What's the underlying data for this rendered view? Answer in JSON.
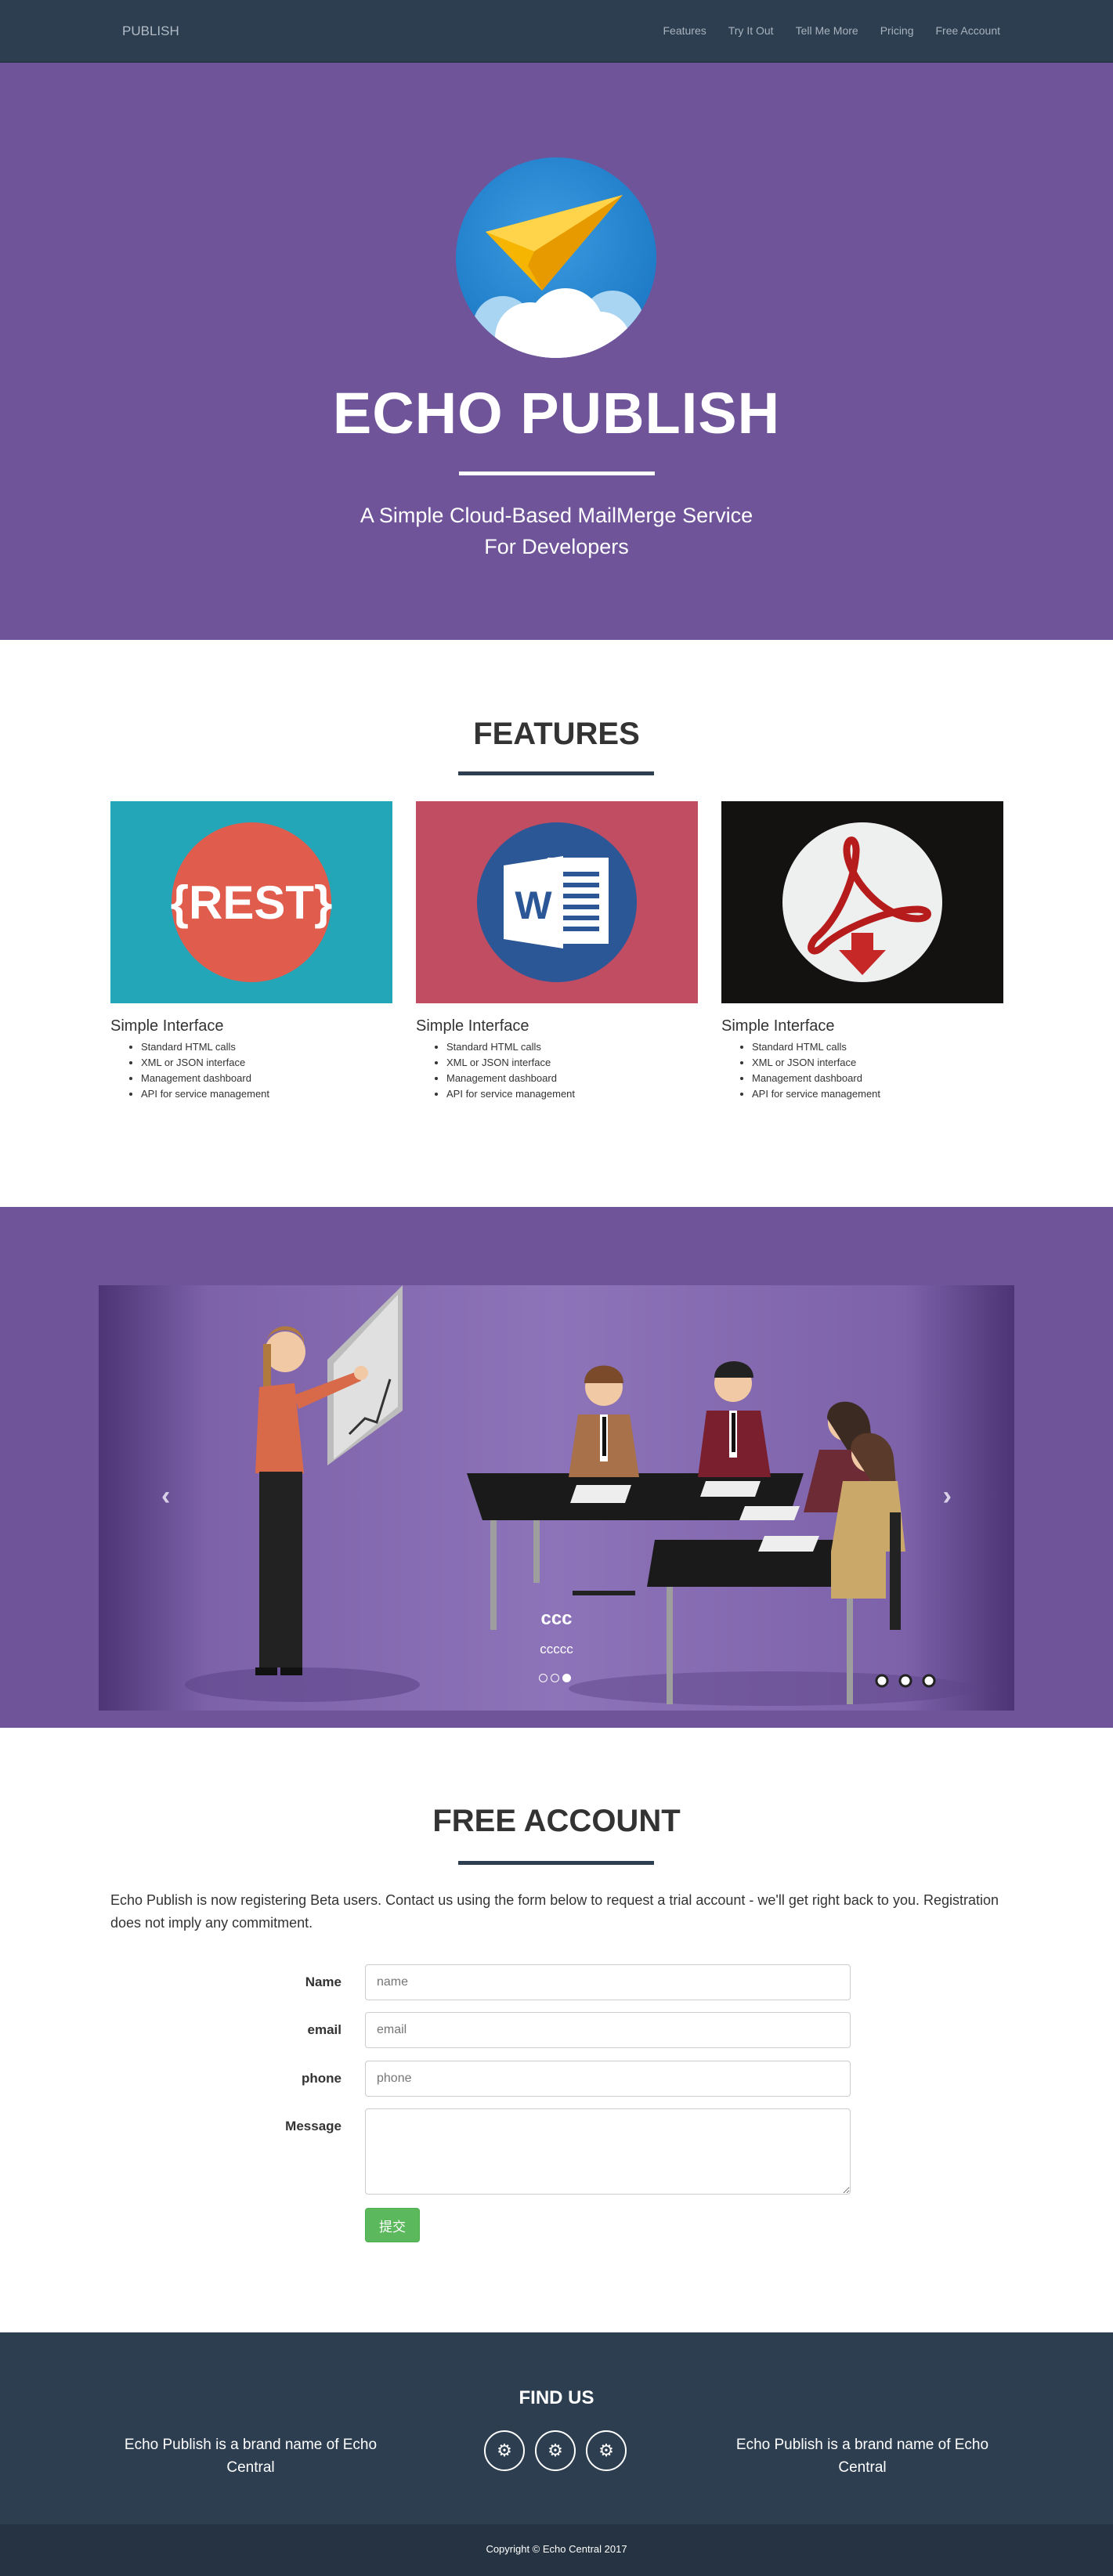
{
  "navbar": {
    "brand": "PUBLISH",
    "links": [
      "Features",
      "Try It Out",
      "Tell Me More",
      "Pricing",
      "Free Account"
    ]
  },
  "hero": {
    "title": "ECHO PUBLISH",
    "subtitle_line1": "A Simple Cloud-Based MailMerge Service",
    "subtitle_line2": "For Developers"
  },
  "features": {
    "title": "FEATURES",
    "items": [
      {
        "icon": "rest-api-icon",
        "image_text": "{REST}",
        "heading": "Simple Interface",
        "bg": "#22a6b8",
        "bullets": [
          "Standard HTML calls",
          "XML or JSON interface",
          "Management dashboard",
          "API for service management"
        ]
      },
      {
        "icon": "word-document-icon",
        "image_text": "W",
        "heading": "Simple Interface",
        "bg": "#c14d63",
        "bullets": [
          "Standard HTML calls",
          "XML or JSON interface",
          "Management dashboard",
          "API for service management"
        ]
      },
      {
        "icon": "pdf-download-icon",
        "image_text": "",
        "heading": "Simple Interface",
        "bg": "#141111",
        "bullets": [
          "Standard HTML calls",
          "XML or JSON interface",
          "Management dashboard",
          "API for service management"
        ]
      }
    ]
  },
  "carousel": {
    "caption_title": "ccc",
    "caption_text": "ccccc",
    "slide_count": 3,
    "active_slide": 3,
    "prev_icon": "chevron-left-icon",
    "next_icon": "chevron-right-icon"
  },
  "free_account": {
    "title": "FREE ACCOUNT",
    "intro": "Echo Publish is now registering Beta users. Contact us using the form below to request a trial account - we'll get right back to you. Registration does not imply any commitment.",
    "fields": {
      "name_label": "Name",
      "name_placeholder": "name",
      "email_label": "email",
      "email_placeholder": "email",
      "phone_label": "phone",
      "phone_placeholder": "phone",
      "message_label": "Message"
    },
    "submit_label": "提交"
  },
  "footer": {
    "find_us": "FIND US",
    "brand_note_left": "Echo Publish is a brand name of Echo Central",
    "brand_note_right": "Echo Publish is a brand name of Echo Central",
    "social_icons": [
      "gear-icon",
      "gear-icon",
      "gear-icon"
    ],
    "copyright": "Copyright © Echo Central 2017"
  },
  "colors": {
    "navbar": "#2c3e50",
    "hero": "#6f5499",
    "accent_rule": "#2c3e50",
    "submit": "#5cb85c"
  }
}
